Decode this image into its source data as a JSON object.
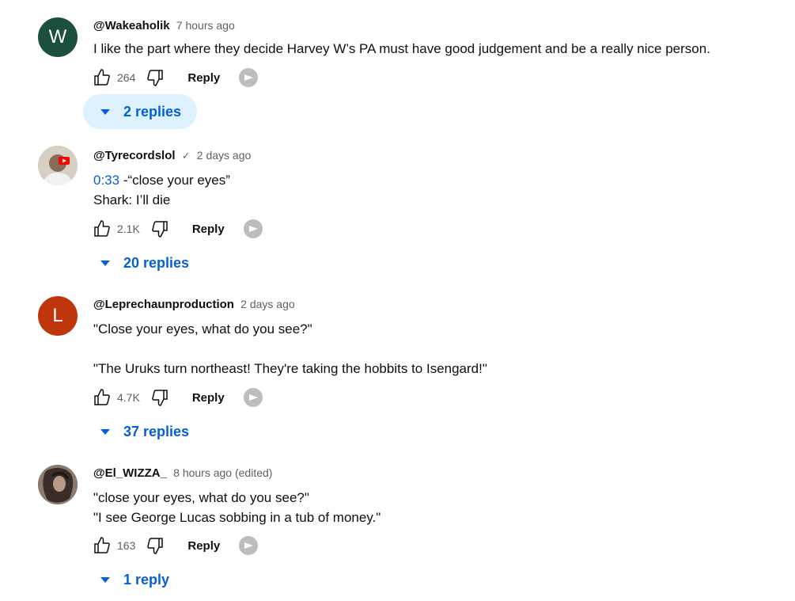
{
  "comments": [
    {
      "avatar_letter": "W",
      "avatar_color": "#1c4f3f",
      "author": "@Wakeaholik",
      "time": "7 hours ago",
      "lines": [
        "I like the part where they decide Harvey W’s PA must have good judgement and be a really nice person."
      ],
      "likes": "264",
      "reply_label": "Reply",
      "replies_label": "2 replies"
    },
    {
      "avatar_letter": "",
      "avatar_color": "#c9b8a8",
      "author": "@Tyrecordslol",
      "verified_icon": "checkmark-icon",
      "time": "2 days ago",
      "timestamp_link": "0:33",
      "line1_rest": " -“close your eyes”",
      "line2": "Shark: I’ll die",
      "likes": "2.1K",
      "reply_label": "Reply",
      "replies_label": "20 replies"
    },
    {
      "avatar_letter": "L",
      "avatar_color": "#c0360c",
      "author": "@Leprechaunproduction",
      "time": "2 days ago",
      "line1": "\"Close your eyes, what do you see?\"",
      "line2": "\"The Uruks turn northeast! They're taking the hobbits to Isengard!\"",
      "likes": "4.7K",
      "reply_label": "Reply",
      "replies_label": "37 replies"
    },
    {
      "avatar_letter": "",
      "avatar_color": "#6d5a50",
      "author": "@El_WIZZA_",
      "time": "8 hours ago (edited)",
      "line1": "\"close your eyes, what do you see?\"",
      "line2": "\"I see George Lucas sobbing in a tub of money.\"",
      "likes": "163",
      "reply_label": "Reply",
      "replies_label": "1 reply"
    }
  ],
  "colors": {
    "link": "#065fd4",
    "meta": "#606060",
    "replies_hover_bg": "#def1ff"
  },
  "icons": [
    "thumbs-up-icon",
    "thumbs-down-icon",
    "creator-heart-icon",
    "caret-down-icon"
  ]
}
